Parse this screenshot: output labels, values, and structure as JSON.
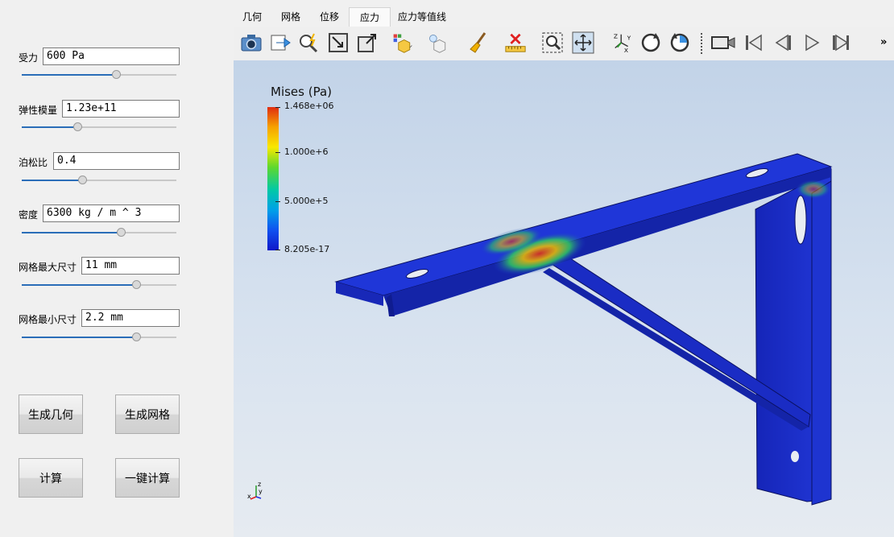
{
  "panel": {
    "params": [
      {
        "label": "受力",
        "value": "600 Pa",
        "slider": 0.61
      },
      {
        "label": "弹性模量",
        "value": "1.23e+11",
        "slider": 0.36
      },
      {
        "label": "泊松比",
        "value": "0.4",
        "slider": 0.39
      },
      {
        "label": "密度",
        "value": "6300 kg / m ^ 3",
        "slider": 0.64
      },
      {
        "label": "网格最大尺寸",
        "value": "11 mm",
        "slider": 0.74
      },
      {
        "label": "网格最小尺寸",
        "value": "2.2 mm",
        "slider": 0.74
      }
    ],
    "buttons": {
      "gen_geometry": "生成几何",
      "gen_mesh": "生成网格",
      "compute": "计算",
      "one_click": "一键计算"
    }
  },
  "tabs": [
    {
      "label": "几何",
      "active": false
    },
    {
      "label": "网格",
      "active": false
    },
    {
      "label": "位移",
      "active": false
    },
    {
      "label": "应力",
      "active": true
    },
    {
      "label": "应力等值线",
      "active": false
    }
  ],
  "toolbar": {
    "icons": [
      "camera-icon",
      "export-icon",
      "pick-icon",
      "reset-camera-icon",
      "zoom-to-box-icon",
      "view-cube-icon",
      "light-icon",
      "paint-icon",
      "ruler-icon",
      "rubber-band-zoom-icon",
      "center-icon",
      "axes-orient-icon",
      "rotate-cw-icon",
      "rotate-ccw-icon",
      "video-camera-icon",
      "first-frame-icon",
      "prev-frame-icon",
      "play-icon",
      "last-frame-icon"
    ],
    "overflow": "»"
  },
  "viewport": {
    "colorbar": {
      "title": "Mises (Pa)",
      "labels": [
        "1.468e+06",
        "1.000e+6",
        "5.000e+5",
        "8.205e-17"
      ]
    },
    "axis_labels": {
      "z": "z",
      "y": "y",
      "x": "x"
    }
  },
  "colors": {
    "accent": "#2a6db8",
    "part": "#1a2fd0"
  }
}
